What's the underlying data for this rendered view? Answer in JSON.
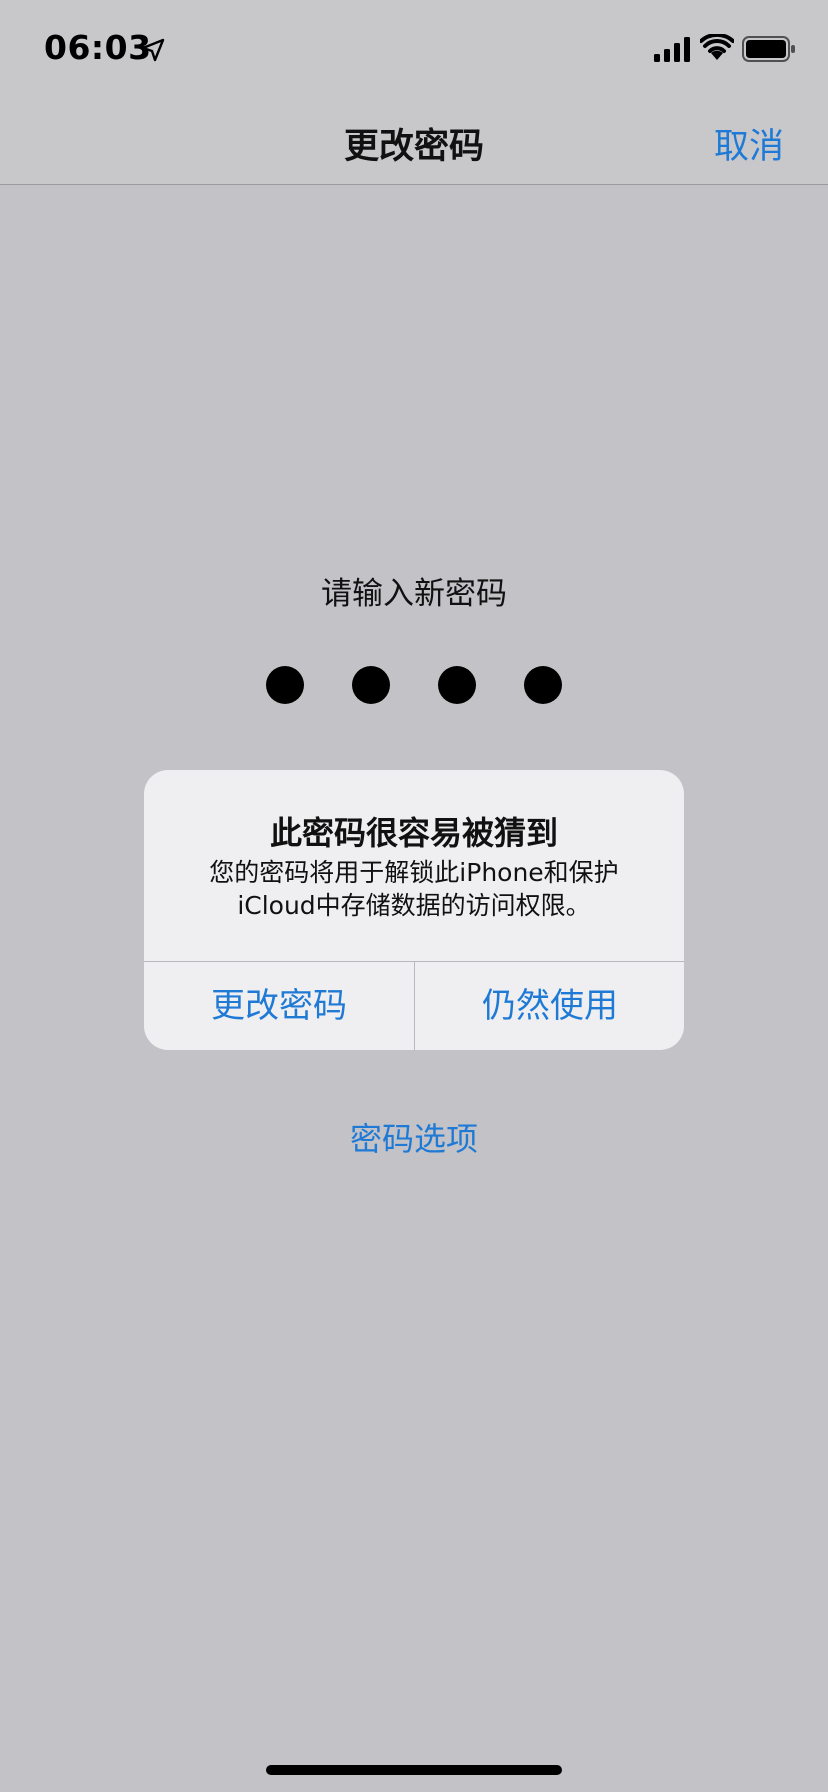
{
  "status_bar": {
    "time": "06:03",
    "icons": [
      "location-arrow-icon",
      "cellular-signal-icon",
      "wifi-icon",
      "battery-icon"
    ]
  },
  "nav": {
    "title": "更改密码",
    "cancel_label": "取消"
  },
  "passcode": {
    "prompt": "请输入新密码",
    "entered_digits": 4
  },
  "alert": {
    "title": "此密码很容易被猜到",
    "message": "您的密码将用于解锁此iPhone和保护iCloud中存储数据的访问权限。",
    "buttons": [
      "更改密码",
      "仍然使用"
    ]
  },
  "options_link": "密码选项",
  "colors": {
    "accent": "#1f7ad6",
    "background": "#c3c2c6",
    "alert_background": "#efeff1"
  }
}
